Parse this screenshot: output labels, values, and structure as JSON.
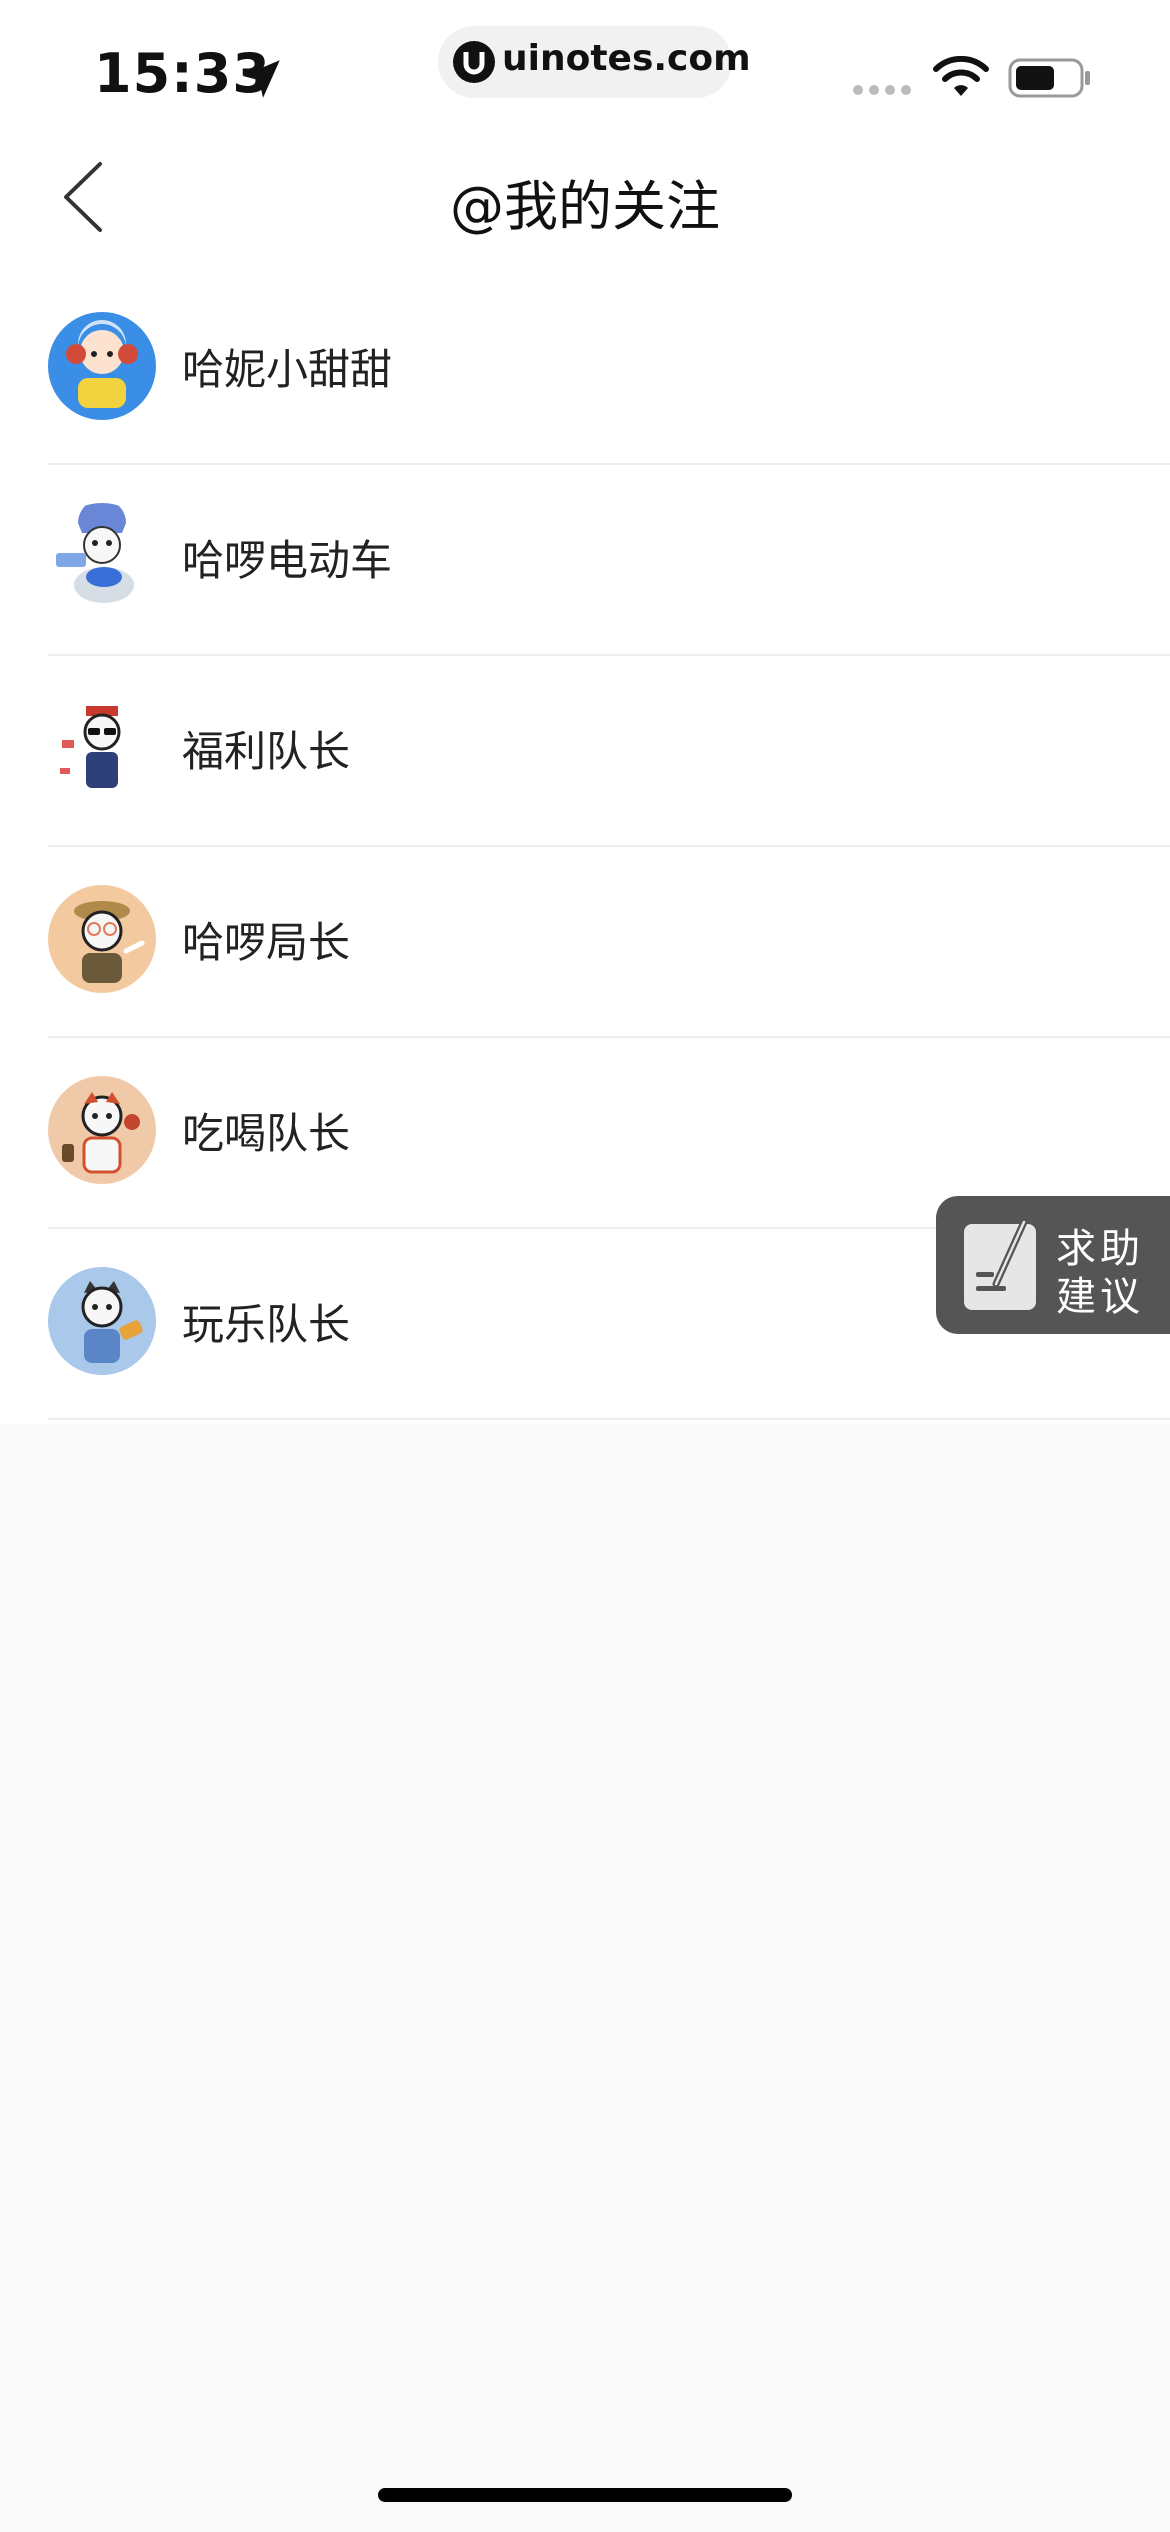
{
  "status_bar": {
    "time": "15:33",
    "url": "uinotes.com"
  },
  "nav": {
    "title": "@我的关注"
  },
  "users": [
    {
      "name": "哈妮小甜甜",
      "avatar_bg": "#3a8ee6"
    },
    {
      "name": "哈啰电动车",
      "avatar_bg": "#ffffff"
    },
    {
      "name": "福利队长",
      "avatar_bg": "#ffffff"
    },
    {
      "name": "哈啰局长",
      "avatar_bg": "#f3c9a0"
    },
    {
      "name": "吃喝队长",
      "avatar_bg": "#f0c9a8"
    },
    {
      "name": "玩乐队长",
      "avatar_bg": "#a9c8ea"
    }
  ],
  "help": {
    "line1": "求助",
    "line2": "建议"
  },
  "colors": {
    "help_bg": "#555555",
    "page_bg": "#f9f9f9"
  }
}
